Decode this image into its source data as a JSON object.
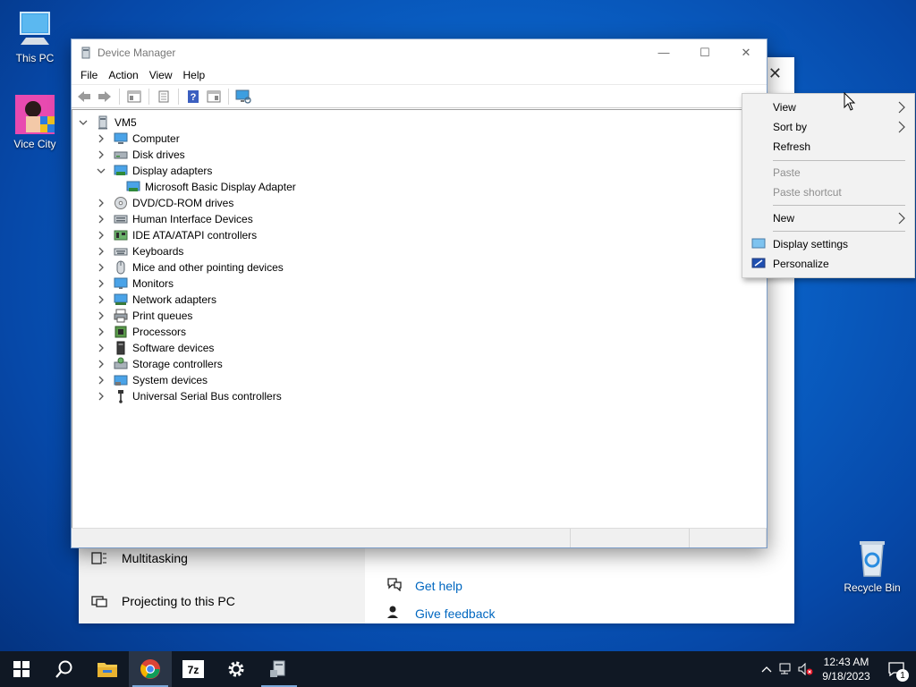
{
  "desktop": {
    "icons": [
      {
        "label": "This PC"
      },
      {
        "label": "Vice City"
      },
      {
        "label": "Recycle Bin"
      }
    ]
  },
  "settings_window": {
    "left_items": [
      {
        "label": "Multitasking"
      },
      {
        "label": "Projecting to this PC"
      }
    ],
    "links": [
      {
        "label": "Get help"
      },
      {
        "label": "Give feedback"
      }
    ]
  },
  "device_manager": {
    "title": "Device Manager",
    "menu": [
      "File",
      "Action",
      "View",
      "Help"
    ],
    "root": "VM5",
    "categories": [
      {
        "label": "Computer",
        "icon": "computer-icon"
      },
      {
        "label": "Disk drives",
        "icon": "disk-drive-icon"
      },
      {
        "label": "Display adapters",
        "icon": "display-adapter-icon",
        "expanded": true
      },
      {
        "label": "Microsoft Basic Display Adapter",
        "icon": "display-adapter-icon",
        "child": true
      },
      {
        "label": "DVD/CD-ROM drives",
        "icon": "dvd-icon"
      },
      {
        "label": "Human Interface Devices",
        "icon": "hid-icon"
      },
      {
        "label": "IDE ATA/ATAPI controllers",
        "icon": "ide-controller-icon"
      },
      {
        "label": "Keyboards",
        "icon": "keyboard-icon"
      },
      {
        "label": "Mice and other pointing devices",
        "icon": "mouse-icon"
      },
      {
        "label": "Monitors",
        "icon": "monitor-icon"
      },
      {
        "label": "Network adapters",
        "icon": "network-adapter-icon"
      },
      {
        "label": "Print queues",
        "icon": "printer-icon"
      },
      {
        "label": "Processors",
        "icon": "processor-icon"
      },
      {
        "label": "Software devices",
        "icon": "software-device-icon"
      },
      {
        "label": "Storage controllers",
        "icon": "storage-controller-icon"
      },
      {
        "label": "System devices",
        "icon": "system-device-icon"
      },
      {
        "label": "Universal Serial Bus controllers",
        "icon": "usb-icon"
      }
    ]
  },
  "context_menu": {
    "items": [
      {
        "label": "View",
        "submenu": true
      },
      {
        "label": "Sort by",
        "submenu": true
      },
      {
        "label": "Refresh"
      },
      {
        "label": "Paste",
        "disabled": true
      },
      {
        "label": "Paste shortcut",
        "disabled": true
      },
      {
        "label": "New",
        "submenu": true
      },
      {
        "label": "Display settings",
        "icon": "display-settings-icon"
      },
      {
        "label": "Personalize",
        "icon": "personalize-icon"
      }
    ]
  },
  "taskbar": {
    "clock_time": "12:43 AM",
    "clock_date": "9/18/2023",
    "notification_count": "1"
  },
  "colors": {
    "link": "#0067c0",
    "taskbar": "#101824",
    "accent": "#0a63c9"
  }
}
